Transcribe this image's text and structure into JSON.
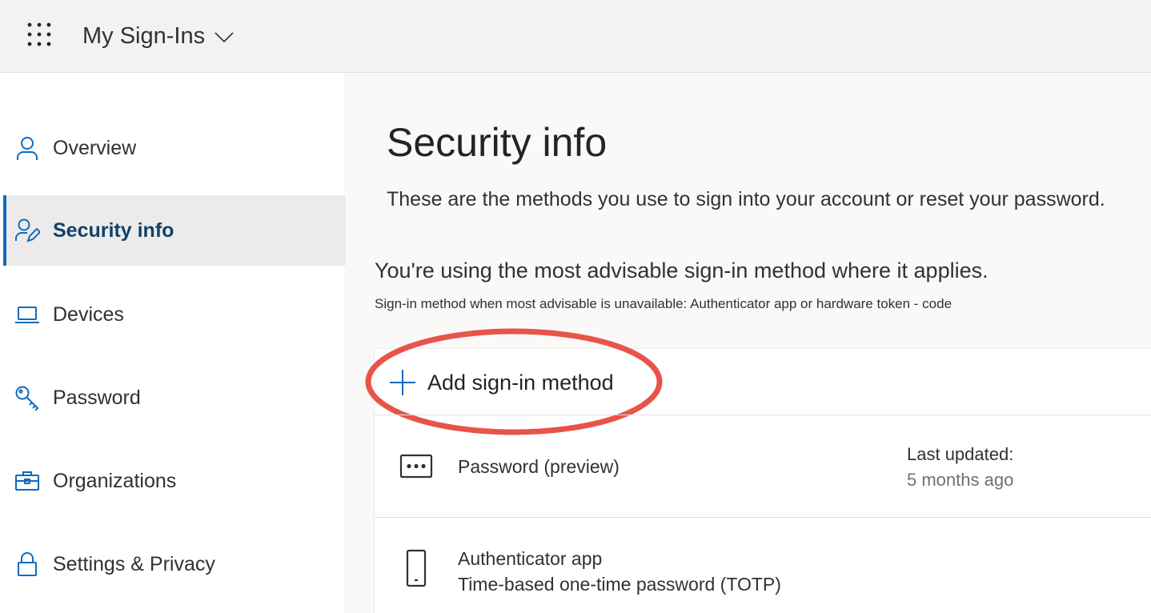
{
  "header": {
    "app_title": "My Sign-Ins"
  },
  "sidebar": {
    "items": [
      {
        "label": "Overview",
        "icon": "person-icon"
      },
      {
        "label": "Security info",
        "icon": "person-edit-icon",
        "active": true
      },
      {
        "label": "Devices",
        "icon": "laptop-icon"
      },
      {
        "label": "Password",
        "icon": "key-icon"
      },
      {
        "label": "Organizations",
        "icon": "briefcase-icon"
      },
      {
        "label": "Settings & Privacy",
        "icon": "lock-icon"
      }
    ]
  },
  "main": {
    "title": "Security info",
    "description": "These are the methods you use to sign into your account or reset your password.",
    "advice_heading": "You're using the most advisable sign-in method where it applies.",
    "advice_sub": "Sign-in method when most advisable is unavailable: Authenticator app or hardware token - code",
    "add_method_label": "Add sign-in method",
    "methods": [
      {
        "name": "Password (preview)",
        "icon": "password-dots-icon",
        "updated_label": "Last updated:",
        "updated_value": "5 months ago"
      },
      {
        "name": "Authenticator app",
        "detail": "Time-based one-time password (TOTP)",
        "icon": "phone-icon"
      }
    ]
  },
  "colors": {
    "accent": "#0f6cbd",
    "active_text": "#11416d",
    "annotation_ellipse": "#e8544a"
  }
}
